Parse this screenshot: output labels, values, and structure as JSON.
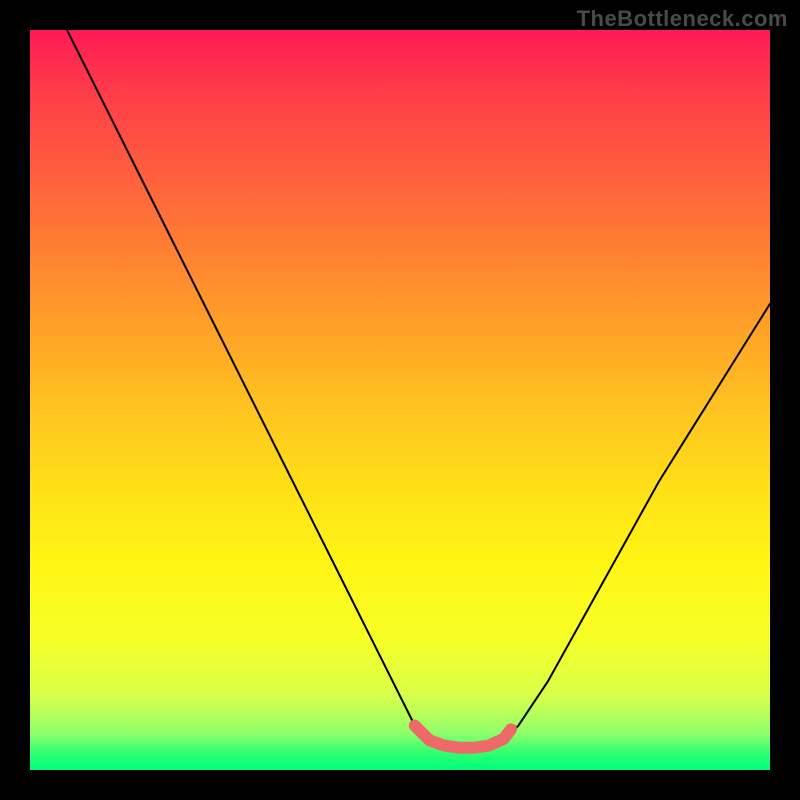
{
  "watermark": "TheBottleneck.com",
  "chart_data": {
    "type": "line",
    "title": "",
    "xlabel": "",
    "ylabel": "",
    "xlim": [
      0,
      100
    ],
    "ylim": [
      0,
      100
    ],
    "series": [
      {
        "name": "bottleneck-curve",
        "x": [
          5,
          10,
          15,
          20,
          25,
          30,
          35,
          40,
          45,
          50,
          52,
          54,
          56,
          58,
          60,
          62,
          64,
          66,
          70,
          75,
          80,
          85,
          90,
          95,
          100
        ],
        "y": [
          100,
          90,
          80,
          70,
          60,
          50,
          40,
          30,
          20,
          10,
          6,
          4,
          3,
          3,
          3,
          3,
          4,
          6,
          12,
          21,
          30,
          39,
          47,
          55,
          63
        ]
      },
      {
        "name": "optimal-region",
        "x": [
          52,
          54,
          56,
          58,
          60,
          62,
          64,
          65
        ],
        "y": [
          6,
          4,
          3.3,
          3,
          3,
          3.3,
          4.2,
          5.5
        ]
      }
    ],
    "gradient_colors": {
      "top": "#ff1a55",
      "mid": "#ffe018",
      "bottom": "#00ff78"
    },
    "annotations": []
  }
}
